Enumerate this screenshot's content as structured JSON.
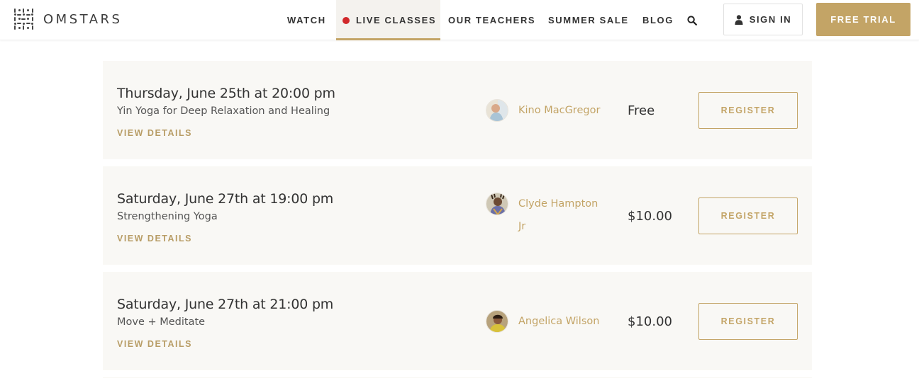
{
  "brand": {
    "name": "OMSTARS",
    "accent": "#c3a466",
    "live_dot": "#d1282b"
  },
  "nav": {
    "watch": "WATCH",
    "live_classes": "LIVE CLASSES",
    "our_teachers": "OUR TEACHERS",
    "summer_sale": "SUMMER SALE",
    "blog": "BLOG",
    "search_icon": "search-icon"
  },
  "account": {
    "sign_in": "SIGN IN",
    "free_trial": "FREE TRIAL"
  },
  "classes": [
    {
      "date": "Thursday, June 25th at 20:00 pm",
      "title": "Yin Yoga for Deep Relaxation and Healing",
      "details": "VIEW DETAILS",
      "teacher": "Kino MacGregor",
      "teacher_line2": "",
      "price": "Free",
      "register": "REGISTER"
    },
    {
      "date": "Saturday, June 27th at 19:00 pm",
      "title": "Strengthening Yoga",
      "details": "VIEW DETAILS",
      "teacher": "Clyde Hampton",
      "teacher_line2": "Jr",
      "price": "$10.00",
      "register": "REGISTER"
    },
    {
      "date": "Saturday, June 27th at 21:00 pm",
      "title": "Move + Meditate",
      "details": "VIEW DETAILS",
      "teacher": "Angelica Wilson",
      "teacher_line2": "",
      "price": "$10.00",
      "register": "REGISTER"
    }
  ]
}
